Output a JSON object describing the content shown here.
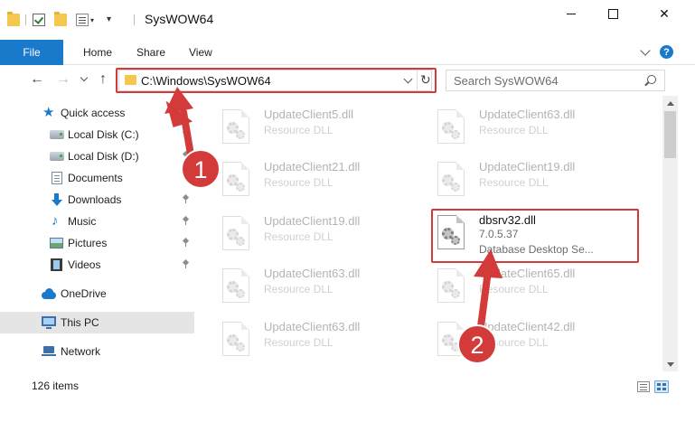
{
  "window": {
    "title": "SysWOW64",
    "close_glyph": "✕"
  },
  "quick_access_toolbar": {
    "dropdown_glyph": "▾"
  },
  "ribbon": {
    "tabs": [
      "File",
      "Home",
      "Share",
      "View"
    ],
    "help_glyph": "?"
  },
  "navigation": {
    "back_glyph": "←",
    "forward_glyph": "→",
    "up_glyph": "↑",
    "address": "C:\\Windows\\SysWOW64",
    "refresh_glyph": "↻",
    "search_placeholder": "Search SysWOW64"
  },
  "nav_pane": {
    "items": [
      {
        "label": "Quick access",
        "icon": "star-icon"
      },
      {
        "label": "Local Disk (C:)",
        "icon": "drive-icon"
      },
      {
        "label": "Local Disk (D:)",
        "icon": "drive-icon"
      },
      {
        "label": "Documents",
        "icon": "documents-icon"
      },
      {
        "label": "Downloads",
        "icon": "downloads-icon"
      },
      {
        "label": "Music",
        "icon": "music-icon"
      },
      {
        "label": "Pictures",
        "icon": "pictures-icon"
      },
      {
        "label": "Videos",
        "icon": "videos-icon"
      },
      {
        "label": "OneDrive",
        "icon": "cloud-icon"
      },
      {
        "label": "This PC",
        "icon": "computer-icon"
      },
      {
        "label": "Network",
        "icon": "network-icon"
      }
    ],
    "star_glyph": "★",
    "music_glyph": "♪",
    "selected": "This PC"
  },
  "files": [
    {
      "name": "UpdateClient5.dll",
      "type": "Resource DLL"
    },
    {
      "name": "UpdateClient63.dll",
      "type": "Resource DLL"
    },
    {
      "name": "UpdateClient21.dll",
      "type": "Resource DLL"
    },
    {
      "name": "UpdateClient19.dll",
      "type": "Resource DLL"
    },
    {
      "name": "UpdateClient19.dll",
      "type": "Resource DLL"
    },
    {
      "name": "dbsrv32.dll",
      "version": "7.0.5.37",
      "description": "Database Desktop Se..."
    },
    {
      "name": "UpdateClient63.dll",
      "type": "Resource DLL"
    },
    {
      "name": "UpdateClient65.dll",
      "type": "Resource DLL"
    },
    {
      "name": "UpdateClient63.dll",
      "type": "Resource DLL"
    },
    {
      "name": "UpdateClient42.dll",
      "type": "Resource DLL"
    }
  ],
  "status": {
    "item_count": "126 items"
  },
  "annotations": {
    "step1": "1",
    "step2": "2",
    "highlight_color": "#d33b3b"
  },
  "colors": {
    "accent": "#1979ca",
    "selected_bg": "#e5e5e5"
  }
}
